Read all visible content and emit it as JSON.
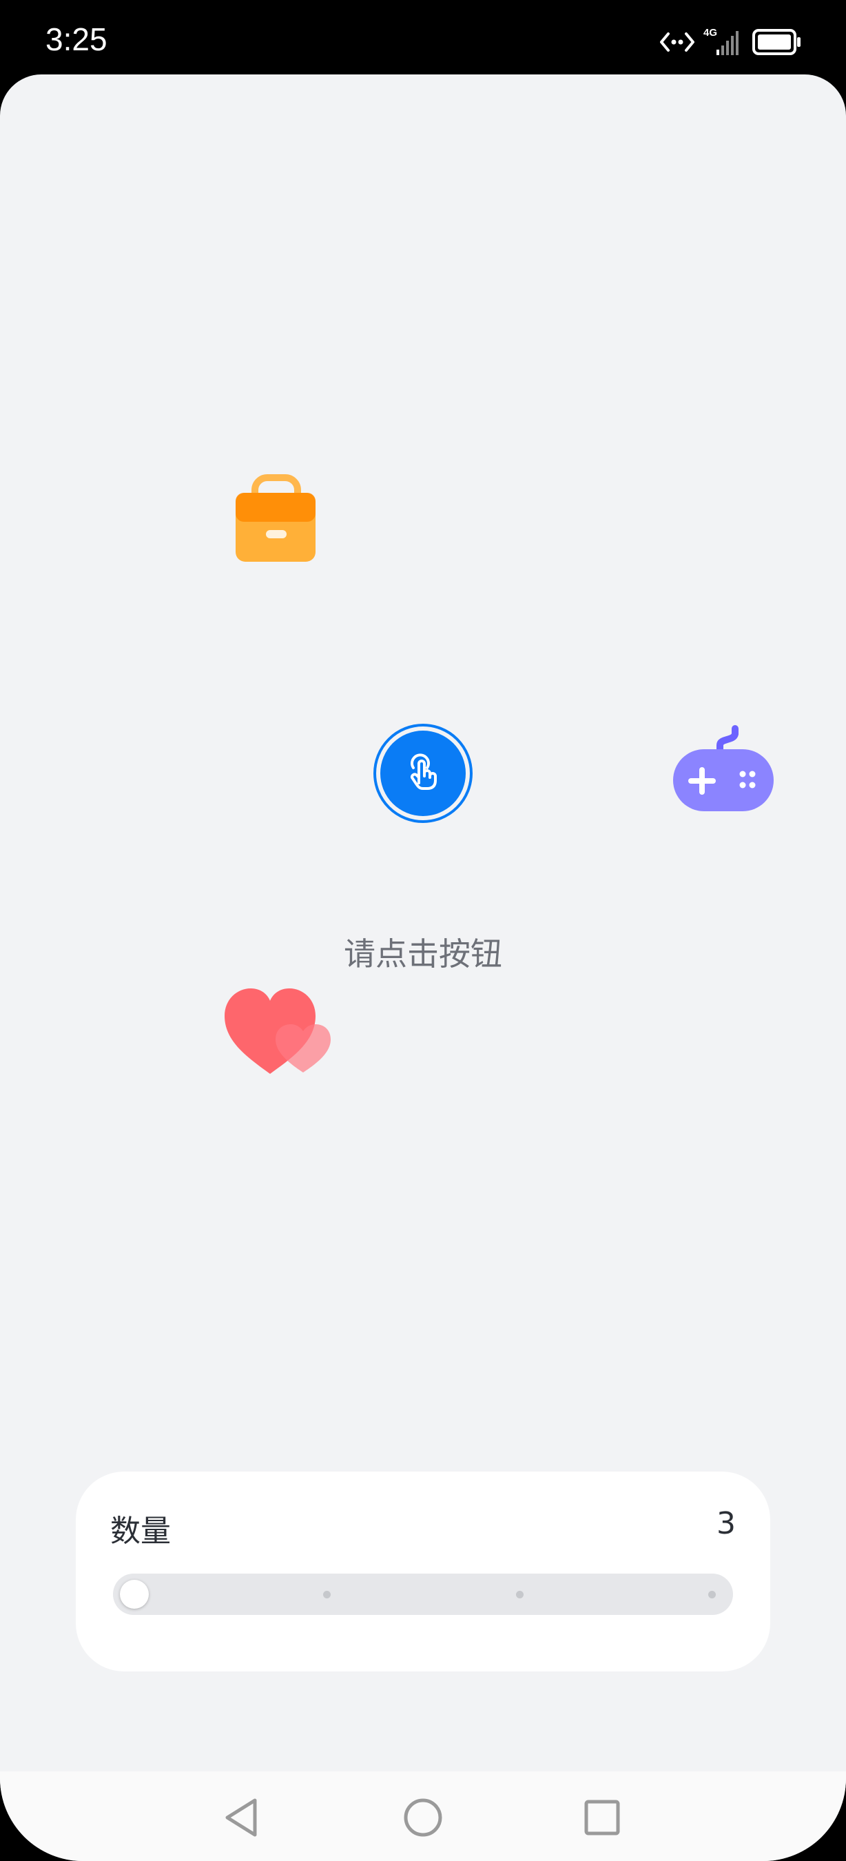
{
  "status_bar": {
    "time": "3:25",
    "network_type": "4G",
    "icons": [
      "data-transfer-icon",
      "signal-icon",
      "battery-icon"
    ]
  },
  "decorations": [
    {
      "name": "briefcase-icon",
      "color": "#ffa726"
    },
    {
      "name": "gamepad-icon",
      "color": "#8b84ff"
    },
    {
      "name": "heart-icon",
      "color": "#ff5a5f"
    }
  ],
  "main": {
    "button_icon": "tap-hand-icon",
    "button_color": "#0a7cf5",
    "hint": "请点击按钮"
  },
  "quantity_card": {
    "label": "数量",
    "value": "3",
    "slider": {
      "steps": 4,
      "current_step": 1
    }
  },
  "nav_bar": {
    "buttons": [
      "back-icon",
      "home-icon",
      "recents-icon"
    ]
  }
}
